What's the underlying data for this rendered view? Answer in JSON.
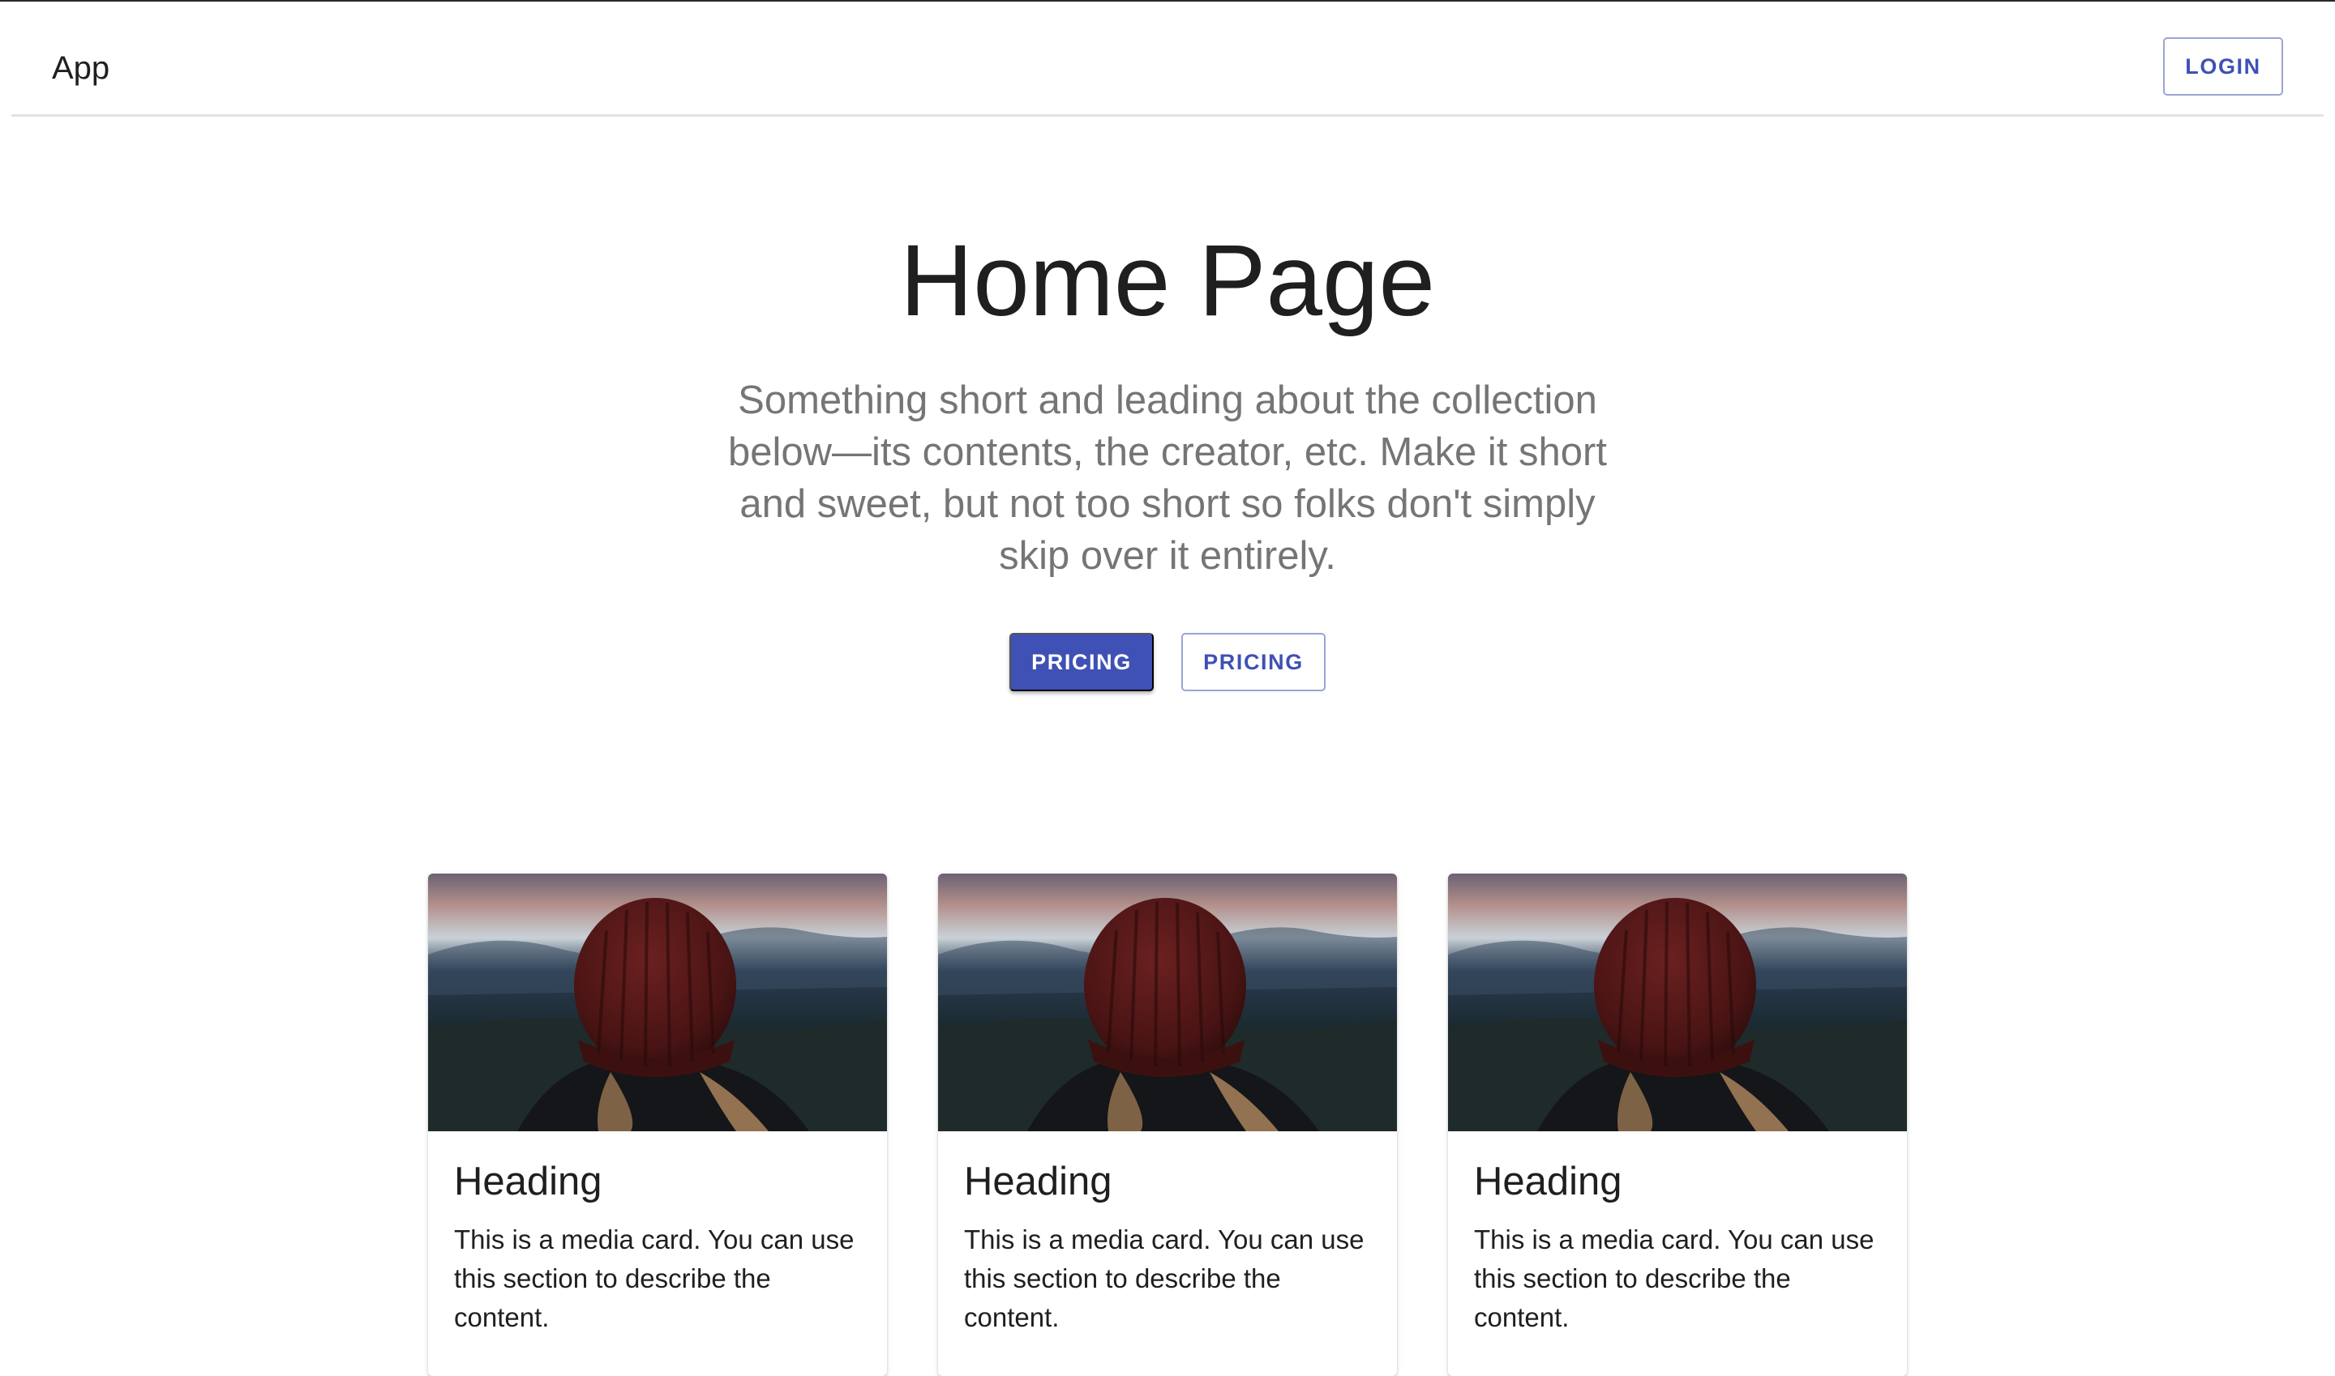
{
  "app": {
    "title": "App",
    "login_label": "LOGIN"
  },
  "hero": {
    "title": "Home Page",
    "subtitle": "Something short and leading about the collection below—its contents, the creator, etc. Make it short and sweet, but not too short so folks don't simply skip over it entirely.",
    "primary_button": "PRICING",
    "secondary_button": "PRICING"
  },
  "cards": [
    {
      "heading": "Heading",
      "text": "This is a media card. You can use this section to describe the content."
    },
    {
      "heading": "Heading",
      "text": "This is a media card. You can use this section to describe the content."
    },
    {
      "heading": "Heading",
      "text": "This is a media card. You can use this section to describe the content."
    }
  ],
  "colors": {
    "primary": "#3f51b5",
    "text": "#1f1f1f",
    "secondary_text": "#757575",
    "divider": "#e3e3e3"
  },
  "icons": {
    "card_media": "card-image-icon"
  }
}
